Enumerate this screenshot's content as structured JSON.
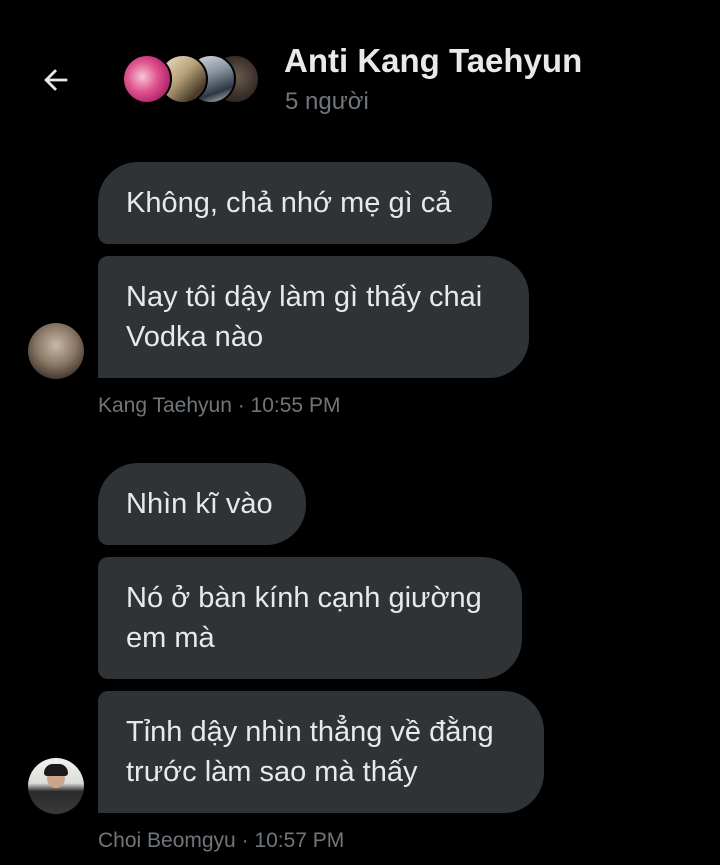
{
  "header": {
    "title": "Anti Kang Taehyun",
    "subtitle": "5 người",
    "back_icon": "arrow-left-icon",
    "group_avatar_count_shown": 4
  },
  "groups": [
    {
      "sender": "Kang Taehyun",
      "time": "10:55 PM",
      "meta": "Kang Taehyun · 10:55 PM",
      "messages": [
        "Không, chả nhớ mẹ gì cả",
        "Nay tôi dậy làm gì thấy chai Vodka nào"
      ]
    },
    {
      "sender": "Choi Beomgyu",
      "time": "10:57 PM",
      "meta": "Choi Beomgyu · 10:57 PM",
      "messages": [
        "Nhìn kĩ vào",
        "Nó ở bàn kính cạnh giường em mà",
        "Tỉnh dậy nhìn thẳng về đằng trước làm sao mà thấy"
      ]
    }
  ],
  "colors": {
    "background": "#000000",
    "bubble": "#2f3336",
    "text": "#e7e9ea",
    "muted": "#71767b"
  }
}
